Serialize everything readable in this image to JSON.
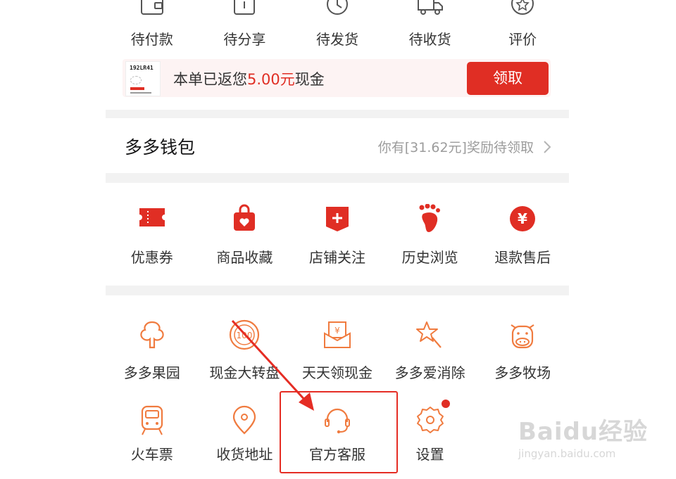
{
  "orders": {
    "items": [
      {
        "label": "待付款",
        "icon": "wallet-icon"
      },
      {
        "label": "待分享",
        "icon": "share-box-icon"
      },
      {
        "label": "待发货",
        "icon": "clock-icon"
      },
      {
        "label": "待收货",
        "icon": "truck-icon"
      },
      {
        "label": "评价",
        "icon": "star-review-icon"
      }
    ]
  },
  "cashback": {
    "thumb_text": "192LR41",
    "prefix": "本单已返您",
    "amount": "5.00元",
    "suffix": "现金",
    "button_label": "领取"
  },
  "wallet": {
    "title": "多多钱包",
    "hint": "你有[31.62元]奖励待领取"
  },
  "services": [
    {
      "label": "优惠券",
      "icon": "coupon-icon"
    },
    {
      "label": "商品收藏",
      "icon": "favorite-bag-icon"
    },
    {
      "label": "店铺关注",
      "icon": "store-follow-icon"
    },
    {
      "label": "历史浏览",
      "icon": "footprint-icon"
    },
    {
      "label": "退款售后",
      "icon": "refund-icon"
    }
  ],
  "tools_row1": [
    {
      "label": "多多果园",
      "icon": "tree-icon"
    },
    {
      "label": "现金大转盘",
      "icon": "wheel-icon"
    },
    {
      "label": "天天领现金",
      "icon": "cash-envelope-icon"
    },
    {
      "label": "多多爱消除",
      "icon": "star-wand-icon"
    },
    {
      "label": "多多牧场",
      "icon": "cow-icon"
    }
  ],
  "tools_row2": [
    {
      "label": "火车票",
      "icon": "train-icon"
    },
    {
      "label": "收货地址",
      "icon": "location-icon"
    },
    {
      "label": "官方客服",
      "icon": "headset-icon"
    },
    {
      "label": "设置",
      "icon": "settings-icon"
    }
  ],
  "watermark": {
    "brand": "Baidu经验",
    "url": "jingyan.baidu.com"
  },
  "colors": {
    "accent": "#e02e24",
    "orange": "#f07b3f",
    "annotation": "#e52d24"
  }
}
